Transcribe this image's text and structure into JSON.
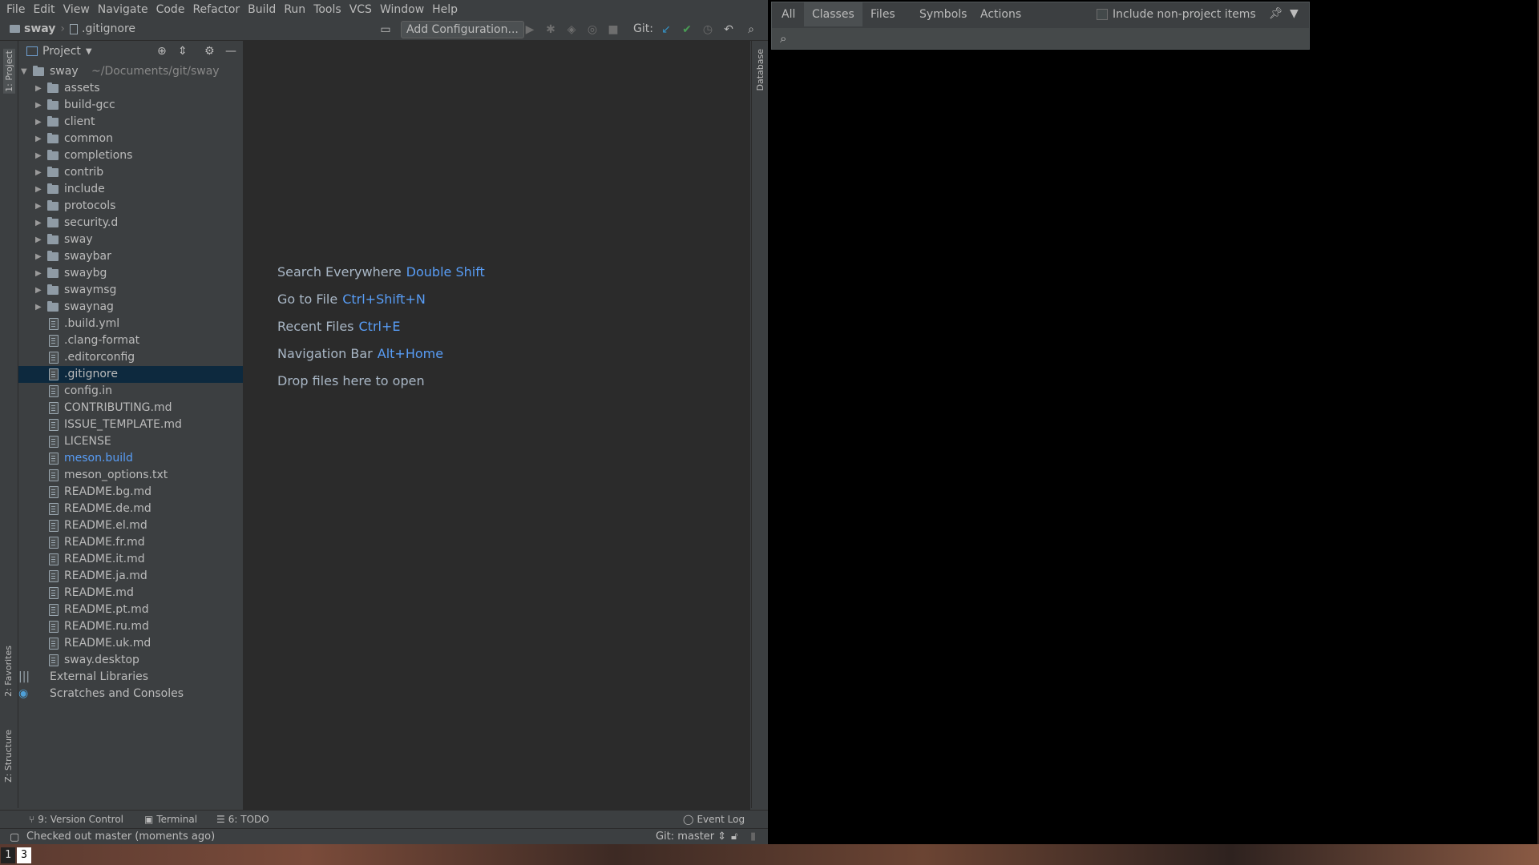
{
  "menu": [
    "File",
    "Edit",
    "View",
    "Navigate",
    "Code",
    "Refactor",
    "Build",
    "Run",
    "Tools",
    "VCS",
    "Window",
    "Help"
  ],
  "breadcrumb": {
    "project": "sway",
    "file": ".gitignore"
  },
  "toolbar": {
    "add_configuration": "Add Configuration...",
    "git_label": "Git:"
  },
  "left_stripe": {
    "project_tab": "1: Project",
    "favorites_tab": "2: Favorites",
    "structure_tab": "Z: Structure"
  },
  "right_stripe": {
    "database_tab": "Database"
  },
  "project_panel": {
    "title": "Project"
  },
  "tree": {
    "root": {
      "name": "sway",
      "path": "~/Documents/git/sway"
    },
    "folders": [
      "assets",
      "build-gcc",
      "client",
      "common",
      "completions",
      "contrib",
      "include",
      "protocols",
      "security.d",
      "sway",
      "swaybar",
      "swaybg",
      "swaymsg",
      "swaynag"
    ],
    "files": [
      ".build.yml",
      ".clang-format",
      ".editorconfig",
      ".gitignore",
      "config.in",
      "CONTRIBUTING.md",
      "ISSUE_TEMPLATE.md",
      "LICENSE",
      "meson.build",
      "meson_options.txt",
      "README.bg.md",
      "README.de.md",
      "README.el.md",
      "README.fr.md",
      "README.it.md",
      "README.ja.md",
      "README.md",
      "README.pt.md",
      "README.ru.md",
      "README.uk.md",
      "sway.desktop"
    ],
    "selected_file": ".gitignore",
    "modified_file": "meson.build",
    "extras": [
      "External Libraries",
      "Scratches and Consoles"
    ]
  },
  "editor_hints": [
    {
      "label": "Search Everywhere",
      "key": "Double Shift"
    },
    {
      "label": "Go to File",
      "key": "Ctrl+Shift+N"
    },
    {
      "label": "Recent Files",
      "key": "Ctrl+E"
    },
    {
      "label": "Navigation Bar",
      "key": "Alt+Home"
    },
    {
      "label": "Drop files here to open",
      "key": ""
    }
  ],
  "bottom_tools": {
    "version_control": "9: Version Control",
    "terminal": "Terminal",
    "todo": "6: TODO",
    "event_log": "Event Log"
  },
  "status": {
    "message": "Checked out master (moments ago)",
    "git_branch": "Git: master"
  },
  "search_popup": {
    "tabs": [
      "All",
      "Classes",
      "Files",
      "Symbols",
      "Actions"
    ],
    "active_tab": "Classes",
    "include_non_project": "Include non-project items",
    "include_non_project_checked": false,
    "query": ""
  },
  "workspaces": [
    "1",
    "3"
  ],
  "active_workspace": "3",
  "colors": {
    "accent_blue": "#589df6",
    "selection": "#0d293e",
    "git_update": "#3592c4",
    "git_commit": "#499c54"
  }
}
